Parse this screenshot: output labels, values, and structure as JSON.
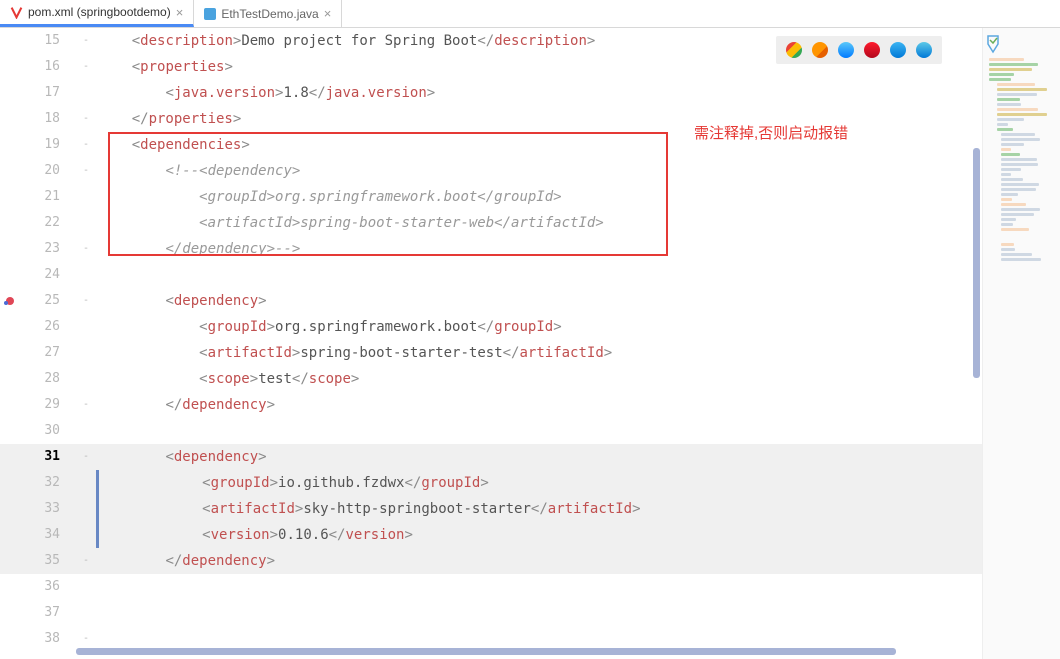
{
  "tabs": [
    {
      "label": "pom.xml (springbootdemo)",
      "active": true
    },
    {
      "label": "EthTestDemo.java",
      "active": false
    }
  ],
  "annotation": "需注释掉,否则启动报错",
  "browsers": [
    {
      "name": "Chrome",
      "color": "linear-gradient(135deg,#ea4335 0 33%,#fbbc05 33% 66%,#34a853 66%)"
    },
    {
      "name": "Firefox",
      "color": "linear-gradient(135deg,#ff9500 0 60%,#e66000 60%)"
    },
    {
      "name": "Safari",
      "color": "linear-gradient(#5ac8fa,#007aff)"
    },
    {
      "name": "Opera",
      "color": "linear-gradient(#ff1b2d,#b2071d)"
    },
    {
      "name": "IE",
      "color": "linear-gradient(#3bb4f2,#0078d7)"
    },
    {
      "name": "Edge",
      "color": "linear-gradient(#5dc9e8,#0078d7)"
    }
  ],
  "lines": [
    {
      "n": 15,
      "fold": "-",
      "html": "    <span class='tag-bracket'>&lt;</span><span class='tag-name'>description</span><span class='tag-bracket'>&gt;</span><span class='tag-text'>Demo project for Spring Boot</span><span class='tag-bracket'>&lt;/</span><span class='tag-name'>description</span><span class='tag-bracket'>&gt;</span>"
    },
    {
      "n": 16,
      "fold": "-",
      "html": "    <span class='tag-bracket'>&lt;</span><span class='tag-name'>properties</span><span class='tag-bracket'>&gt;</span>"
    },
    {
      "n": 17,
      "html": "        <span class='tag-bracket'>&lt;</span><span class='tag-name'>java.version</span><span class='tag-bracket'>&gt;</span><span class='tag-text'>1.8</span><span class='tag-bracket'>&lt;/</span><span class='tag-name'>java.version</span><span class='tag-bracket'>&gt;</span>"
    },
    {
      "n": 18,
      "fold": "-",
      "html": "    <span class='tag-bracket'>&lt;/</span><span class='tag-name'>properties</span><span class='tag-bracket'>&gt;</span>"
    },
    {
      "n": 19,
      "fold": "-",
      "html": "    <span class='tag-bracket'>&lt;</span><span class='tag-name'>dependencies</span><span class='tag-bracket'>&gt;</span>"
    },
    {
      "n": 20,
      "fold": "-",
      "html": "        <span class='comment-text'>&lt;!--&lt;dependency&gt;</span>"
    },
    {
      "n": 21,
      "html": "            <span class='comment-text'>&lt;groupId&gt;org.springframework.boot&lt;/groupId&gt;</span>"
    },
    {
      "n": 22,
      "html": "            <span class='comment-text'>&lt;artifactId&gt;spring-boot-starter-web&lt;/artifactId&gt;</span>"
    },
    {
      "n": 23,
      "fold": "-",
      "html": "        <span class='comment-text'>&lt;/dependency&gt;--&gt;</span>"
    },
    {
      "n": 24,
      "html": ""
    },
    {
      "n": 25,
      "bp": true,
      "fold": "-",
      "html": "        <span class='tag-bracket'>&lt;</span><span class='tag-name'>dependency</span><span class='tag-bracket'>&gt;</span>"
    },
    {
      "n": 26,
      "html": "            <span class='tag-bracket'>&lt;</span><span class='tag-name'>groupId</span><span class='tag-bracket'>&gt;</span><span class='tag-text'>org.springframework.boot</span><span class='tag-bracket'>&lt;/</span><span class='tag-name'>groupId</span><span class='tag-bracket'>&gt;</span>"
    },
    {
      "n": 27,
      "html": "            <span class='tag-bracket'>&lt;</span><span class='tag-name'>artifactId</span><span class='tag-bracket'>&gt;</span><span class='tag-text'>spring-boot-starter-test</span><span class='tag-bracket'>&lt;/</span><span class='tag-name'>artifactId</span><span class='tag-bracket'>&gt;</span>"
    },
    {
      "n": 28,
      "html": "            <span class='tag-bracket'>&lt;</span><span class='tag-name'>scope</span><span class='tag-bracket'>&gt;</span><span class='tag-text'>test</span><span class='tag-bracket'>&lt;/</span><span class='tag-name'>scope</span><span class='tag-bracket'>&gt;</span>"
    },
    {
      "n": 29,
      "fold": "-",
      "html": "        <span class='tag-bracket'>&lt;/</span><span class='tag-name'>dependency</span><span class='tag-bracket'>&gt;</span>"
    },
    {
      "n": 30,
      "html": ""
    },
    {
      "n": 31,
      "fold": "-",
      "active": true,
      "hl": true,
      "html": "        <span class='tag-bracket'>&lt;</span><span class='tag-name'>dependency</span><span class='tag-bracket'>&gt;</span>"
    },
    {
      "n": 32,
      "hl": true,
      "html": "            <span class='tag-bracket'>&lt;</span><span class='tag-name'>groupId</span><span class='tag-bracket'>&gt;</span><span class='tag-text'>io.github.fzdwx</span><span class='tag-bracket'>&lt;/</span><span class='tag-name'>groupId</span><span class='tag-bracket'>&gt;</span>"
    },
    {
      "n": 33,
      "hl": true,
      "html": "            <span class='tag-bracket'>&lt;</span><span class='tag-name'>artifactId</span><span class='tag-bracket'>&gt;</span><span class='tag-text'>sky-http-springboot-starter</span><span class='tag-bracket'>&lt;/</span><span class='tag-name'>artifactId</span><span class='tag-bracket'>&gt;</span>"
    },
    {
      "n": 34,
      "hl": true,
      "html": "            <span class='tag-bracket'>&lt;</span><span class='tag-name'>version</span><span class='tag-bracket'>&gt;</span><span class='tag-text'>0.10.6</span><span class='tag-bracket'>&lt;/</span><span class='tag-name'>version</span><span class='tag-bracket'>&gt;</span>"
    },
    {
      "n": 35,
      "fold": "-",
      "hl": true,
      "html": "        <span class='tag-bracket'>&lt;/</span><span class='tag-name'>dependency</span><span class='tag-bracket'>&gt;</span>"
    },
    {
      "n": 36,
      "html": ""
    },
    {
      "n": 37,
      "html": ""
    },
    {
      "n": 38,
      "fold": "-",
      "html": ""
    }
  ]
}
